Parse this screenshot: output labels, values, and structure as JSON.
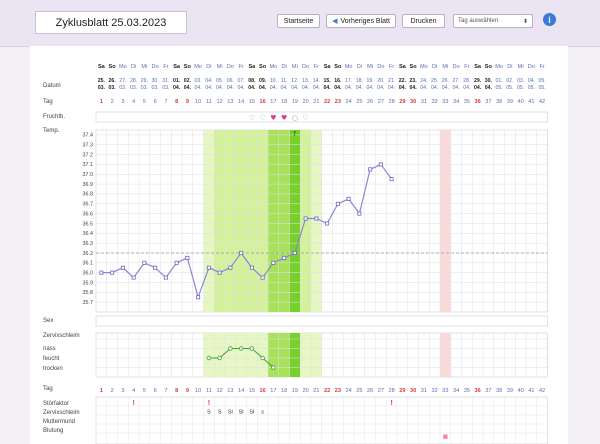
{
  "header": {
    "title": "Zyklusblatt 25.03.2023",
    "buttons": {
      "home": "Startseite",
      "prev": "Vorheriges Blatt",
      "print": "Drucken"
    },
    "day_select": {
      "value": "Tag auswählen"
    }
  },
  "labels": {
    "datum": "Datum",
    "tag": "Tag",
    "fruchtb": "Fruchtb.",
    "temp": "Temp.",
    "sex": "Sex",
    "zervix": "Zervixschleim",
    "zervix_levels": [
      "nass",
      "feucht",
      "trocken"
    ],
    "tag_bottom": "Tag",
    "stoerfaktor": "Störfaktor",
    "zervix_bottom": "Zervixschleim",
    "muttermund": "Muttermund",
    "blutung": "Blutung"
  },
  "weekdays": [
    "Sa",
    "So",
    "Mo",
    "Di",
    "Mi",
    "Do",
    "Fr",
    "Sa",
    "So",
    "Mo",
    "Di",
    "Mi",
    "Do",
    "Fr",
    "Sa",
    "So",
    "Mo",
    "Di",
    "Mi",
    "Do",
    "Fr",
    "Sa",
    "So",
    "Mo",
    "Di",
    "Mi",
    "Do",
    "Fr",
    "Sa",
    "So",
    "Mo",
    "Di",
    "Mi",
    "Do",
    "Fr",
    "Sa",
    "So",
    "Mo",
    "Di",
    "Mi",
    "Do",
    "Fr"
  ],
  "dates_day": [
    "25.",
    "26.",
    "27.",
    "28.",
    "29.",
    "30.",
    "31.",
    "01.",
    "02.",
    "03.",
    "04.",
    "05.",
    "06.",
    "07.",
    "08.",
    "09.",
    "10.",
    "11.",
    "12.",
    "13.",
    "14.",
    "15.",
    "16.",
    "17.",
    "18.",
    "19.",
    "20.",
    "21.",
    "22.",
    "23.",
    "24.",
    "25.",
    "26.",
    "27.",
    "28.",
    "29.",
    "30.",
    "01.",
    "02.",
    "03.",
    "04.",
    "05."
  ],
  "dates_month": [
    "03.",
    "03.",
    "03.",
    "03.",
    "03.",
    "03.",
    "03.",
    "04.",
    "04.",
    "04.",
    "04.",
    "04.",
    "04.",
    "04.",
    "04.",
    "04.",
    "04.",
    "04.",
    "04.",
    "04.",
    "04.",
    "04.",
    "04.",
    "04.",
    "04.",
    "04.",
    "04.",
    "04.",
    "04.",
    "04.",
    "04.",
    "04.",
    "04.",
    "04.",
    "04.",
    "04.",
    "04.",
    "05.",
    "05.",
    "05.",
    "05.",
    "05."
  ],
  "bold_days": [
    1,
    2,
    8,
    9,
    15,
    16,
    22,
    23,
    29,
    30,
    36,
    37
  ],
  "red_days": [
    1,
    8,
    9,
    16,
    22,
    23,
    29,
    30,
    36
  ],
  "temp_ticks": [
    "37.4",
    "37.3",
    "37.2",
    "37.1",
    "37.0",
    "36.9",
    "36.8",
    "36.7",
    "36.6",
    "36.5",
    "36.4",
    "36.3",
    "36.2",
    "36.1",
    "36.0",
    "35.9",
    "35.8",
    "35.7"
  ],
  "temps": [
    36.0,
    36.0,
    36.05,
    35.95,
    36.1,
    36.05,
    35.95,
    36.1,
    36.15,
    35.75,
    36.05,
    36.0,
    36.05,
    36.2,
    36.05,
    35.95,
    36.1,
    36.15,
    36.2,
    36.55,
    36.55,
    36.5,
    36.7,
    36.75,
    36.6,
    37.05,
    37.1,
    36.95
  ],
  "baseline": 36.2,
  "fertile_light": [
    11,
    21
  ],
  "fertile_dark": [
    17,
    19
  ],
  "peak_day": 19,
  "period_mark_day": 33,
  "fruchtb_icons": [
    {
      "day": 15,
      "icon": "heart-outline-icon"
    },
    {
      "day": 16,
      "icon": "heart-outline-icon"
    },
    {
      "day": 17,
      "icon": "heart-filled-icon"
    },
    {
      "day": 18,
      "icon": "heart-filled-icon"
    },
    {
      "day": 19,
      "icon": "circle-icon"
    },
    {
      "day": 20,
      "icon": "heart-outline-icon"
    }
  ],
  "zervix_curve": [
    [
      11,
      2
    ],
    [
      12,
      2
    ],
    [
      13,
      1
    ],
    [
      14,
      1
    ],
    [
      15,
      1
    ],
    [
      16,
      2
    ],
    [
      17,
      3
    ]
  ],
  "stoer_days": [
    4,
    11,
    28
  ],
  "zervix_codes": [
    {
      "day": 11,
      "code": "S"
    },
    {
      "day": 12,
      "code": "S"
    },
    {
      "day": 13,
      "code": "SI"
    },
    {
      "day": 14,
      "code": "SI"
    },
    {
      "day": 15,
      "code": "SI"
    },
    {
      "day": 16,
      "code": "s"
    }
  ],
  "blutung_days": [
    33
  ]
}
